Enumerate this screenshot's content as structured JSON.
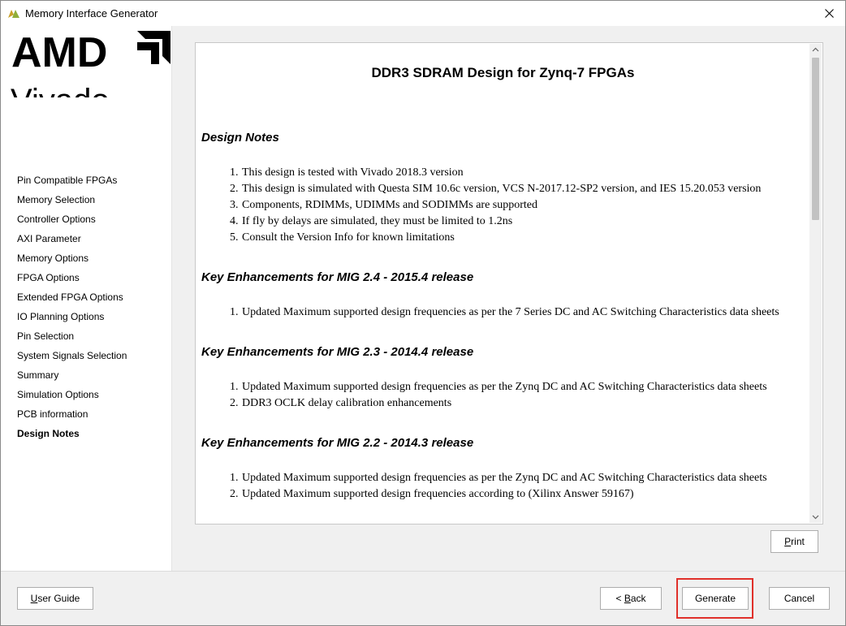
{
  "window": {
    "title": "Memory Interface Generator"
  },
  "logo": {
    "brand": "AMD",
    "product": "Vivado"
  },
  "sidebar": {
    "items": [
      {
        "label": "Pin Compatible FPGAs",
        "active": false
      },
      {
        "label": "Memory Selection",
        "active": false
      },
      {
        "label": "Controller Options",
        "active": false
      },
      {
        "label": "AXI Parameter",
        "active": false
      },
      {
        "label": "Memory Options",
        "active": false
      },
      {
        "label": "FPGA Options",
        "active": false
      },
      {
        "label": "Extended FPGA Options",
        "active": false
      },
      {
        "label": "IO Planning Options",
        "active": false
      },
      {
        "label": "Pin Selection",
        "active": false
      },
      {
        "label": "System Signals Selection",
        "active": false
      },
      {
        "label": "Summary",
        "active": false
      },
      {
        "label": "Simulation Options",
        "active": false
      },
      {
        "label": "PCB information",
        "active": false
      },
      {
        "label": "Design Notes",
        "active": true
      }
    ]
  },
  "doc": {
    "title": "DDR3 SDRAM Design for Zynq-7 FPGAs",
    "design_notes": {
      "heading": "Design Notes",
      "items": [
        "This design is tested with Vivado 2018.3 version",
        "This design is simulated with Questa SIM 10.6c version, VCS N-2017.12-SP2 version, and IES 15.20.053 version",
        "Components, RDIMMs, UDIMMs and SODIMMs are supported",
        "If fly by delays are simulated, they must be limited to 1.2ns",
        "Consult the Version Info for known limitations"
      ]
    },
    "enh_24": {
      "heading": "Key Enhancements for MIG 2.4 - 2015.4 release",
      "items": [
        "Updated Maximum supported design frequencies as per the 7 Series DC and AC Switching Characteristics data sheets"
      ]
    },
    "enh_23": {
      "heading": "Key Enhancements for MIG 2.3 - 2014.4 release",
      "items": [
        "Updated Maximum supported design frequencies as per the Zynq DC and AC Switching Characteristics data sheets",
        "DDR3 OCLK delay calibration enhancements"
      ]
    },
    "enh_22": {
      "heading": "Key Enhancements for MIG 2.2 - 2014.3 release",
      "items": [
        "Updated Maximum supported design frequencies as per the Zynq DC and AC Switching Characteristics data sheets",
        "Updated Maximum supported design frequencies according to (Xilinx Answer 59167)"
      ]
    },
    "numbers": [
      "1.",
      "2.",
      "3.",
      "4.",
      "5."
    ]
  },
  "buttons": {
    "print": {
      "mnemonic": "P",
      "rest": "rint"
    },
    "user_guide": {
      "mnemonic": "U",
      "rest": "ser Guide"
    },
    "back": {
      "prefix": "< ",
      "mnemonic": "B",
      "rest": "ack"
    },
    "generate": "Generate",
    "cancel": "Cancel"
  },
  "colors": {
    "highlight": "#e0302a",
    "logo_color": "#000000",
    "titlebar_icon": "#c8a028"
  },
  "icons": {
    "app": "vivado-logo-icon",
    "close": "close-icon",
    "scroll_up": "chevron-up-icon",
    "scroll_down": "chevron-down-icon"
  }
}
